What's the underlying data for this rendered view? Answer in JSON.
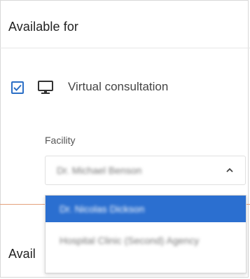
{
  "section": {
    "title": "Available for"
  },
  "virtual_consultation": {
    "checked": true,
    "label": "Virtual consultation",
    "icon": "monitor-icon"
  },
  "facility": {
    "label": "Facility",
    "selected_value": "Dr. Michael Benson",
    "options": [
      "Dr. Nicolas Dickson",
      "Hospital Clinic (Second) Agency"
    ],
    "highlighted_index": 0
  },
  "lower_section": {
    "title_partial": "Avail"
  },
  "colors": {
    "accent": "#2b6fd0",
    "checkbox_border": "#2b6fc6",
    "divider_orange": "#e4a17c"
  }
}
